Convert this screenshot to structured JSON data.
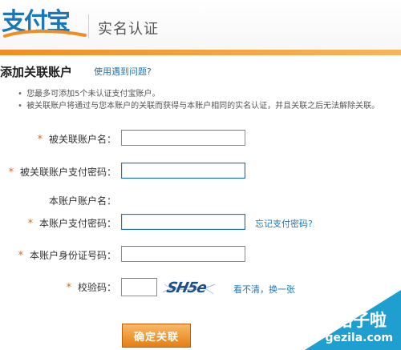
{
  "header": {
    "logo_text": "支付宝",
    "section_title": "实名认证"
  },
  "page": {
    "title": "添加关联账户",
    "help_link": "使用遇到问题?"
  },
  "notes": [
    "您最多可添加5个未认证支付宝账户。",
    "被关联账户将通过与您本账户的关联而获得与本账户相同的实名认证，并且关联之后无法解除关联。"
  ],
  "form": {
    "required_mark": "*",
    "fields": [
      {
        "label": "被关联账户名：",
        "value": "",
        "required": true
      },
      {
        "label": "被关联账户支付密码：",
        "value": "",
        "required": true
      },
      {
        "label": "本账户账户名：",
        "value": "",
        "required": false
      },
      {
        "label": "本账户支付密码：",
        "value": "",
        "required": true,
        "link": "忘记支付密码?"
      },
      {
        "label": "本账户身份证号码：",
        "value": "",
        "required": true
      },
      {
        "label": "校验码：",
        "value": "",
        "required": true,
        "captcha_text": "SH5e",
        "link": "看不清，换一张"
      }
    ],
    "submit_label": "确定关联"
  },
  "watermark": {
    "title": "格子啦",
    "url": "gezila.com"
  },
  "colors": {
    "brand_blue": "#1b76b8",
    "accent_orange": "#f08e24",
    "required_star": "#e2641a",
    "watermark_blue": "#1e9fcf"
  },
  "icons": {
    "bullet": "bullet-icon",
    "required": "required-star-icon"
  }
}
